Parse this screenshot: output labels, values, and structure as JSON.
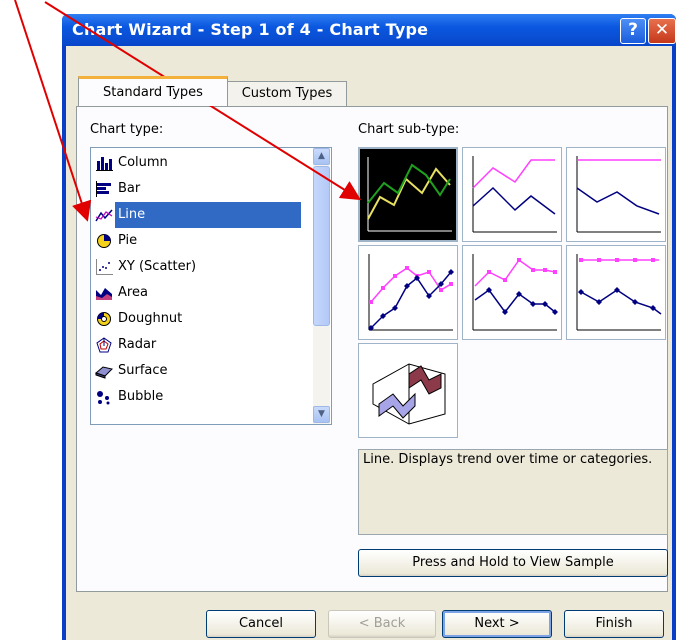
{
  "window": {
    "title": "Chart Wizard - Step 1 of 4 - Chart Type",
    "help_label": "?",
    "close_label": "✕"
  },
  "tabs": [
    {
      "label": "Standard Types",
      "active": true
    },
    {
      "label": "Custom Types",
      "active": false
    }
  ],
  "chart_type": {
    "label": "Chart type:",
    "items": [
      {
        "label": "Column",
        "icon": "column-chart-icon"
      },
      {
        "label": "Bar",
        "icon": "bar-chart-icon"
      },
      {
        "label": "Line",
        "icon": "line-chart-icon",
        "selected": true
      },
      {
        "label": "Pie",
        "icon": "pie-chart-icon"
      },
      {
        "label": "XY (Scatter)",
        "icon": "scatter-chart-icon"
      },
      {
        "label": "Area",
        "icon": "area-chart-icon"
      },
      {
        "label": "Doughnut",
        "icon": "doughnut-chart-icon"
      },
      {
        "label": "Radar",
        "icon": "radar-chart-icon"
      },
      {
        "label": "Surface",
        "icon": "surface-chart-icon"
      },
      {
        "label": "Bubble",
        "icon": "bubble-chart-icon"
      }
    ]
  },
  "chart_subtype": {
    "label": "Chart sub-type:",
    "selected_index": 0
  },
  "description": "Line. Displays trend over time or categories.",
  "sample_button": "Press and Hold to View Sample",
  "buttons": {
    "cancel": "Cancel",
    "back": "< Back",
    "next": "Next >",
    "finish": "Finish"
  },
  "colors": {
    "annotation_arrow": "#e00000",
    "selection": "#316ac5",
    "titlebar": "#0b58e0"
  }
}
